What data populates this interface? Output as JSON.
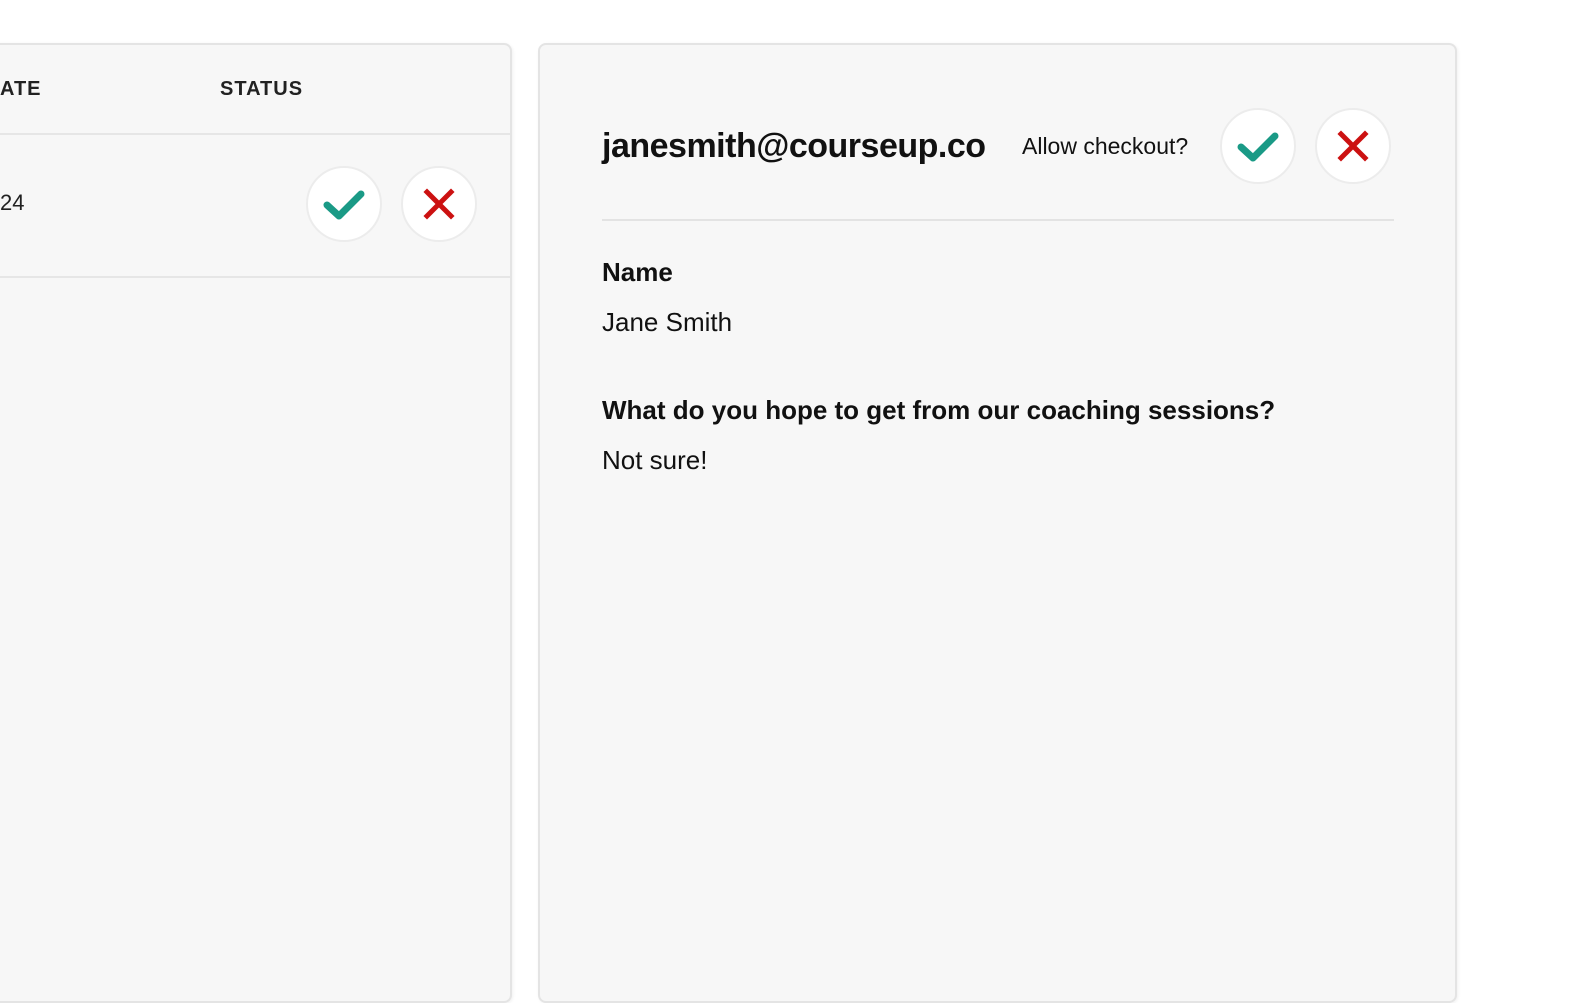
{
  "table": {
    "columns": [
      "ATE",
      "STATUS"
    ],
    "rows": [
      {
        "date_fragment": "24",
        "approve_icon": "checkmark-icon",
        "reject_icon": "x-icon"
      }
    ]
  },
  "detail": {
    "email": "janesmith@courseup.co",
    "allow_checkout_label": "Allow checkout?",
    "approve_icon": "checkmark-icon",
    "reject_icon": "x-icon",
    "fields": [
      {
        "label": "Name",
        "value": "Jane Smith"
      },
      {
        "label": "What do you hope to get from our coaching sessions?",
        "value": "Not sure!"
      }
    ]
  },
  "colors": {
    "approve": "#1a9a86",
    "reject": "#cc1111",
    "panel_bg": "#f7f7f7",
    "border": "#e4e4e4"
  }
}
